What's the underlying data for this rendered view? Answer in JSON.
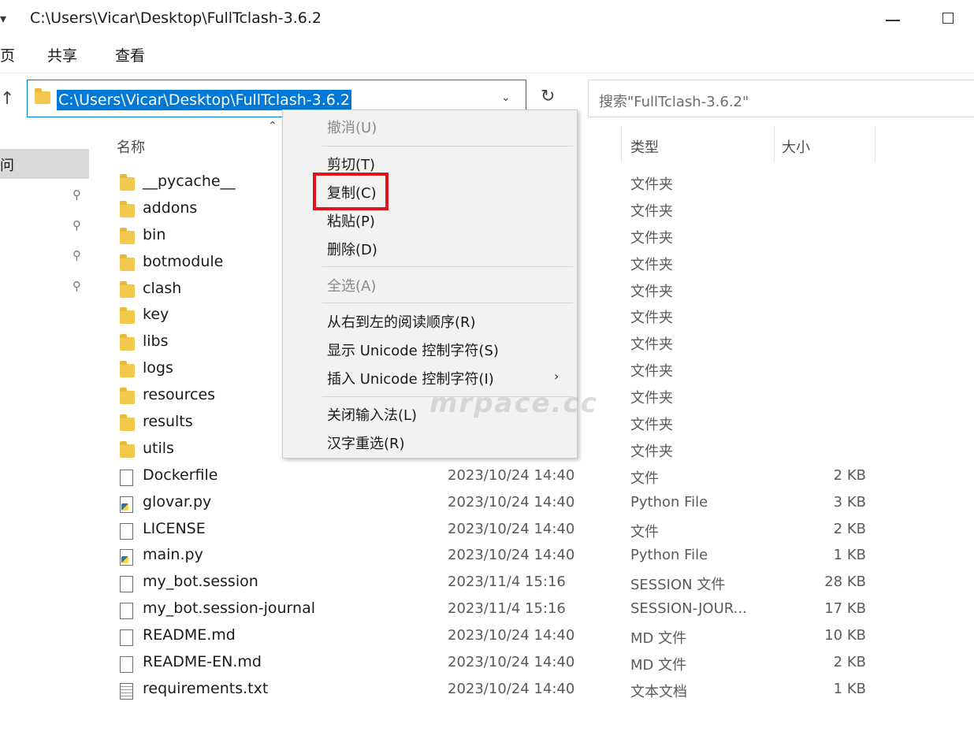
{
  "window": {
    "caret_icon": "quick-access-dropdown",
    "title": "C:\\Users\\Vicar\\Desktop\\FullTclash-3.6.2"
  },
  "ribbon": {
    "tabs": [
      "页",
      "共享",
      "查看"
    ]
  },
  "address_bar": {
    "path": "C:\\Users\\Vicar\\Desktop\\FullTclash-3.6.2",
    "up_icon": "↑",
    "chevron_icon": "⌄",
    "refresh_icon": "↻"
  },
  "search": {
    "placeholder": "搜索\"FullTclash-3.6.2\""
  },
  "nav_pane": {
    "selected_label": "问",
    "pin_icon": "📌"
  },
  "columns": {
    "name": "名称",
    "type": "类型",
    "size": "大小"
  },
  "files": [
    {
      "name": "__pycache__",
      "date": "",
      "type": "文件夹",
      "size": "",
      "icon": "folder"
    },
    {
      "name": "addons",
      "date": "",
      "type": "文件夹",
      "size": "",
      "icon": "folder"
    },
    {
      "name": "bin",
      "date": "",
      "type": "文件夹",
      "size": "",
      "icon": "folder"
    },
    {
      "name": "botmodule",
      "date": "",
      "type": "文件夹",
      "size": "",
      "icon": "folder"
    },
    {
      "name": "clash",
      "date": "",
      "type": "文件夹",
      "size": "",
      "icon": "folder"
    },
    {
      "name": "key",
      "date": "",
      "type": "文件夹",
      "size": "",
      "icon": "folder"
    },
    {
      "name": "libs",
      "date": "",
      "type": "文件夹",
      "size": "",
      "icon": "folder"
    },
    {
      "name": "logs",
      "date": "",
      "type": "文件夹",
      "size": "",
      "icon": "folder"
    },
    {
      "name": "resources",
      "date": "",
      "type": "文件夹",
      "size": "",
      "icon": "folder"
    },
    {
      "name": "results",
      "date": "",
      "type": "文件夹",
      "size": "",
      "icon": "folder"
    },
    {
      "name": "utils",
      "date": "",
      "type": "文件夹",
      "size": "",
      "icon": "folder"
    },
    {
      "name": "Dockerfile",
      "date": "2023/10/24 14:40",
      "type": "文件",
      "size": "2 KB",
      "icon": "file"
    },
    {
      "name": "glovar.py",
      "date": "2023/10/24 14:40",
      "type": "Python File",
      "size": "3 KB",
      "icon": "py"
    },
    {
      "name": "LICENSE",
      "date": "2023/10/24 14:40",
      "type": "文件",
      "size": "2 KB",
      "icon": "file"
    },
    {
      "name": "main.py",
      "date": "2023/10/24 14:40",
      "type": "Python File",
      "size": "1 KB",
      "icon": "py"
    },
    {
      "name": "my_bot.session",
      "date": "2023/11/4 15:16",
      "type": "SESSION 文件",
      "size": "28 KB",
      "icon": "file"
    },
    {
      "name": "my_bot.session-journal",
      "date": "2023/11/4 15:16",
      "type": "SESSION-JOUR...",
      "size": "17 KB",
      "icon": "file"
    },
    {
      "name": "README.md",
      "date": "2023/10/24 14:40",
      "type": "MD 文件",
      "size": "10 KB",
      "icon": "file"
    },
    {
      "name": "README-EN.md",
      "date": "2023/10/24 14:40",
      "type": "MD 文件",
      "size": "2 KB",
      "icon": "file"
    },
    {
      "name": "requirements.txt",
      "date": "2023/10/24 14:40",
      "type": "文本文档",
      "size": "1 KB",
      "icon": "txt"
    }
  ],
  "context_menu": {
    "items": [
      {
        "label": "撤消(U)",
        "disabled": true
      },
      {
        "label": "剪切(T)",
        "disabled": false
      },
      {
        "label": "复制(C)",
        "disabled": false,
        "highlighted": true
      },
      {
        "label": "粘贴(P)",
        "disabled": false
      },
      {
        "label": "删除(D)",
        "disabled": false
      },
      {
        "label": "全选(A)",
        "disabled": true
      },
      {
        "label": "从右到左的阅读顺序(R)",
        "disabled": false
      },
      {
        "label": "显示 Unicode 控制字符(S)",
        "disabled": false
      },
      {
        "label": "插入 Unicode 控制字符(I)",
        "disabled": false,
        "submenu": true
      },
      {
        "label": "关闭输入法(L)",
        "disabled": false
      },
      {
        "label": "汉字重选(R)",
        "disabled": false
      }
    ],
    "submenu_arrow": "›",
    "highlight_color": "#e0151c"
  },
  "watermark": "mrpace.cc",
  "colors": {
    "selection": "#0078d7",
    "folder": "#f2c94c"
  }
}
